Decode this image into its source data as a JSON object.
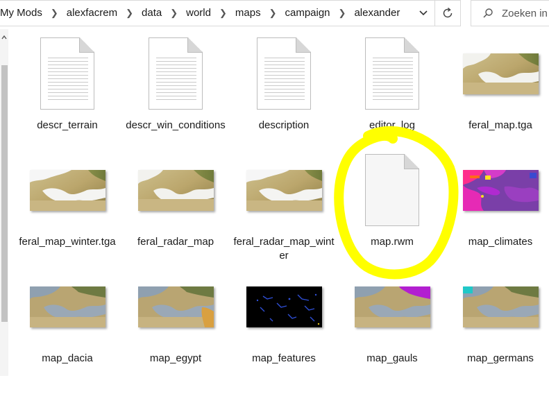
{
  "addressbar": {
    "breadcrumbs": [
      "My Mods",
      "alexfacrem",
      "data",
      "world",
      "maps",
      "campaign",
      "alexander"
    ],
    "separator_icon": "chevron-right-icon",
    "dropdown_icon": "chevron-down-icon",
    "refresh_icon": "refresh-icon"
  },
  "search": {
    "placeholder": "Zoeken in alexander",
    "icon": "search-icon"
  },
  "scrollbar": {
    "up_icon": "scroll-up-arrow-icon"
  },
  "annotation": {
    "color": "#ffff00",
    "target": "map.rwm"
  },
  "files": [
    {
      "name": "descr_terrain",
      "kind": "document-icon"
    },
    {
      "name": "descr_win_conditions",
      "kind": "document-icon"
    },
    {
      "name": "description",
      "kind": "document-icon"
    },
    {
      "name": "editor_log",
      "kind": "document-icon"
    },
    {
      "name": "feral_map.tga",
      "kind": "terrain-thumbnail"
    },
    {
      "name": "feral_map_winter.tga",
      "kind": "terrain-thumbnail"
    },
    {
      "name": "feral_radar_map",
      "kind": "terrain-thumbnail"
    },
    {
      "name": "feral_radar_map_winter",
      "kind": "terrain-thumbnail"
    },
    {
      "name": "map.rwm",
      "kind": "blank-file-icon"
    },
    {
      "name": "map_climates",
      "kind": "climate-thumbnail"
    },
    {
      "name": "map_dacia",
      "kind": "region-thumbnail"
    },
    {
      "name": "map_egypt",
      "kind": "region-thumbnail"
    },
    {
      "name": "map_features",
      "kind": "features-thumbnail"
    },
    {
      "name": "map_gauls",
      "kind": "region-thumbnail"
    },
    {
      "name": "map_germans",
      "kind": "region-thumbnail"
    }
  ]
}
